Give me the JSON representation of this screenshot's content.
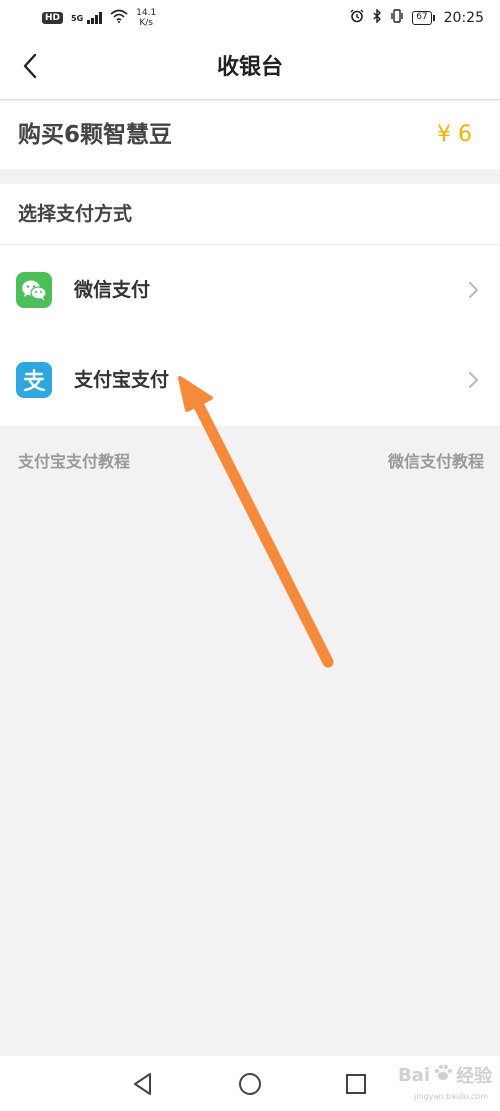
{
  "status_bar": {
    "hd": "HD",
    "network": "5G",
    "speed_value": "14.1",
    "speed_unit": "K/s",
    "battery": "67",
    "time": "20:25"
  },
  "nav": {
    "title": "收银台"
  },
  "product": {
    "name": "购买6颗智慧豆",
    "price": "¥ 6"
  },
  "payment": {
    "header": "选择支付方式",
    "methods": [
      {
        "label": "微信支付",
        "icon": "wechat-icon",
        "color": "#4cbf5a"
      },
      {
        "label": "支付宝支付",
        "icon": "alipay-icon",
        "color": "#2ea7e0"
      }
    ]
  },
  "tutorials": {
    "alipay": "支付宝支付教程",
    "wechat": "微信支付教程"
  },
  "colors": {
    "price": "#f0b400",
    "annotation_arrow": "#f58a3a"
  },
  "watermark": {
    "brand": "Bai",
    "brand_suffix": "经验",
    "url": "jingyan.baidu.com"
  }
}
